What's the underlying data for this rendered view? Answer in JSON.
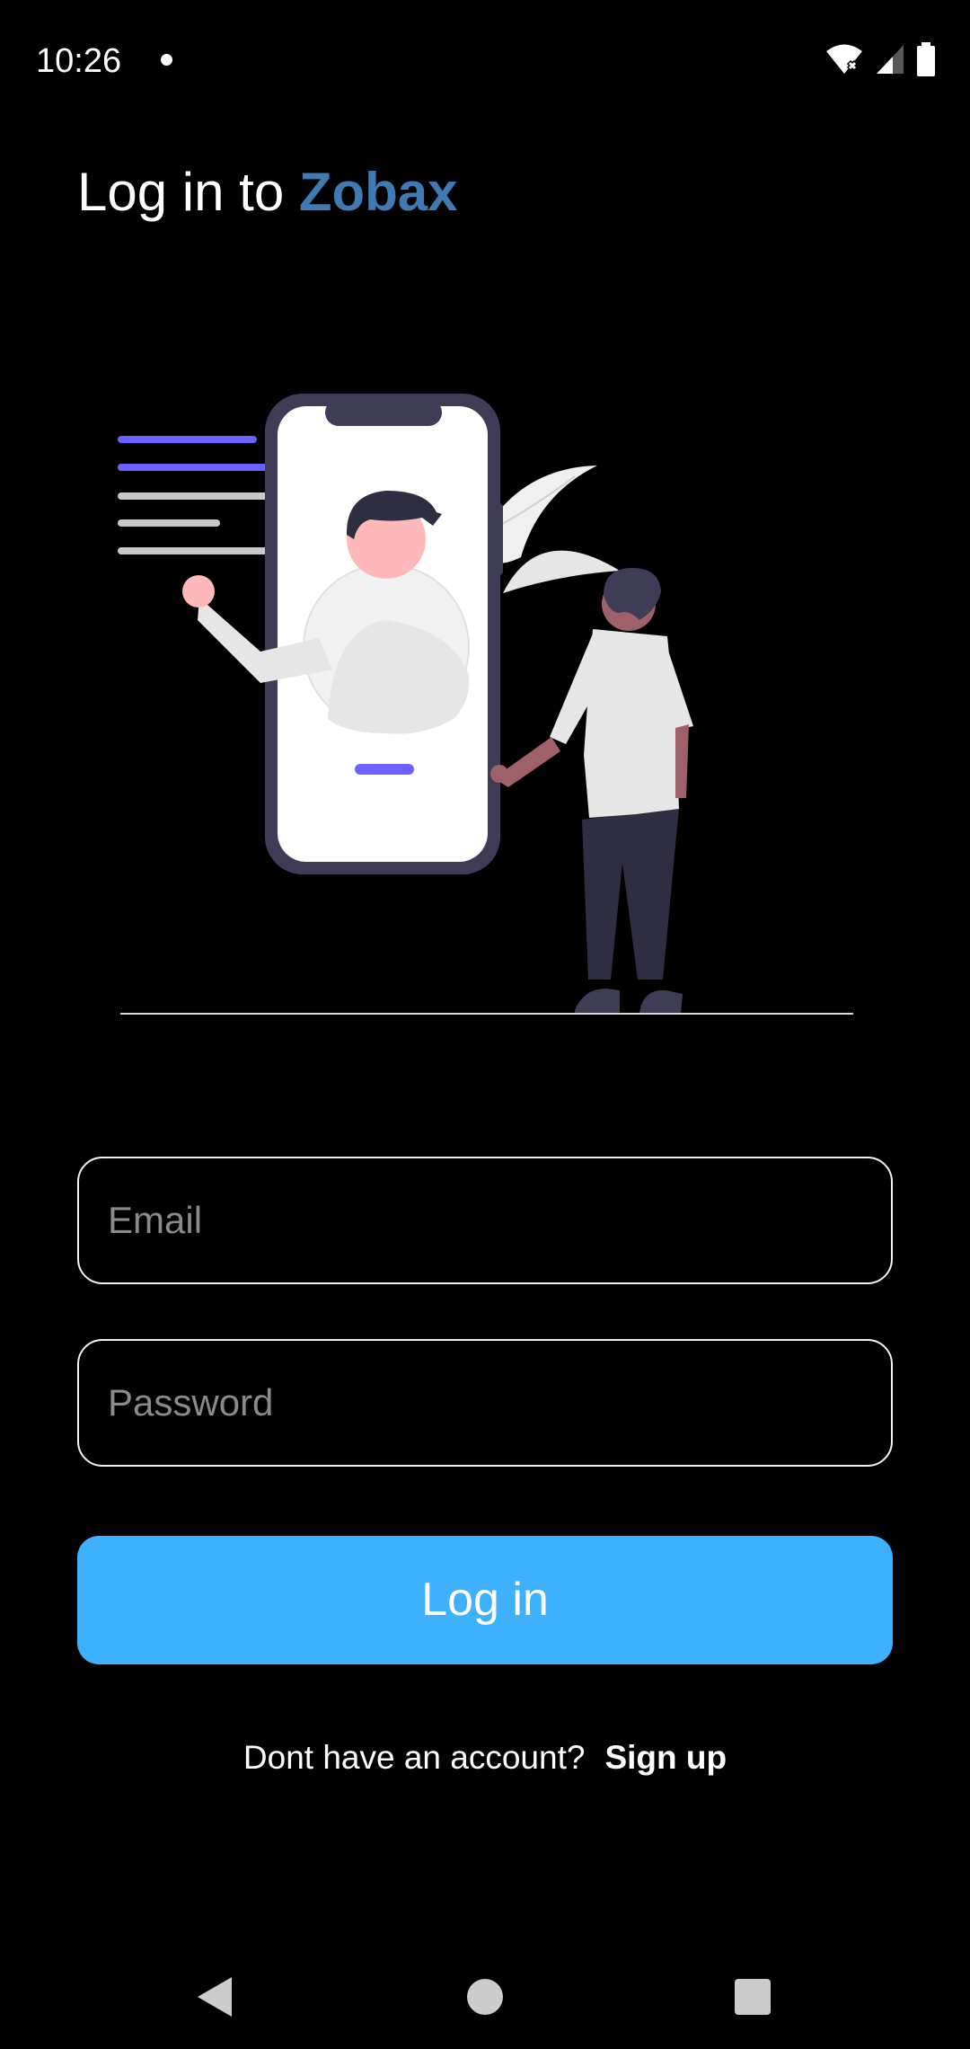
{
  "status_bar": {
    "time": "10:26",
    "icons": [
      "notification-dot-icon",
      "wifi-off-icon",
      "signal-icon",
      "battery-icon"
    ]
  },
  "header": {
    "title_prefix": "Log in to",
    "brand": "Zobax"
  },
  "form": {
    "email_placeholder": "Email",
    "email_value": "",
    "password_placeholder": "Password",
    "password_value": "",
    "login_label": "Log in"
  },
  "footer": {
    "prompt": "Dont have an account?",
    "signup_label": "Sign up"
  },
  "nav": {
    "icons": [
      "back-icon",
      "home-icon",
      "recents-icon"
    ]
  },
  "colors": {
    "background": "#000000",
    "brand": "#3f7ab5",
    "button": "#3fb0fb",
    "illustration_accent": "#6c63ff"
  }
}
